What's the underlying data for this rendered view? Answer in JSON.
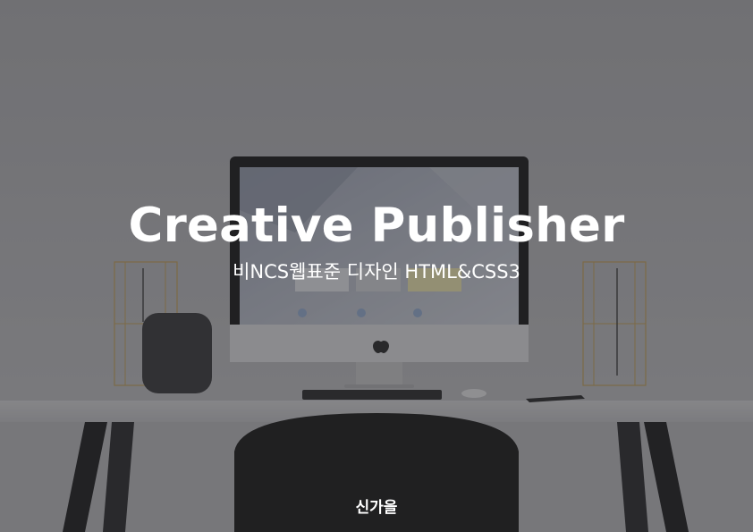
{
  "cover": {
    "title": "Creative Publisher",
    "subtitle": "비NCS웹표준 디자인 HTML&CSS3",
    "author": "신가을"
  },
  "colors": {
    "overlay": "#28282c",
    "text": "#ffffff"
  },
  "background": {
    "description_icons": [
      "desk",
      "imac-monitor",
      "apple-logo-icon",
      "keyboard",
      "mouse",
      "smartphone",
      "speaker",
      "lamp",
      "chair"
    ]
  }
}
